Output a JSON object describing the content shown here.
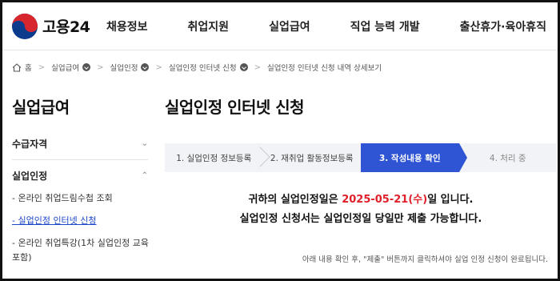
{
  "header": {
    "logo_text": "고용24",
    "menu": [
      "채용정보",
      "취업지원",
      "실업급여",
      "직업 능력 개발",
      "출산휴가·육아휴직"
    ]
  },
  "breadcrumb": {
    "home": "홈",
    "items": [
      "실업급여",
      "실업인정",
      "실업인정 인터넷 신청",
      "실업인정 인터넷 신청 내역 상세보기"
    ]
  },
  "sidebar": {
    "title": "실업급여",
    "groups": [
      {
        "label": "수급자격",
        "expanded": false
      },
      {
        "label": "실업인정",
        "expanded": true
      }
    ],
    "subitems": [
      {
        "label": "- 온라인 취업드림수첩 조회",
        "active": false
      },
      {
        "label": "- 실업인정 인터넷 신청",
        "active": true
      },
      {
        "label": "- 온라인 취업특강(1차 실업인정 교육 포함)",
        "active": false
      }
    ]
  },
  "main": {
    "title": "실업인정 인터넷 신청",
    "steps": [
      {
        "label": "1. 실업인정 정보등록",
        "state": "done"
      },
      {
        "label": "2. 재취업 활동정보등록",
        "state": "done"
      },
      {
        "label": "3. 작성내용 확인",
        "state": "current"
      },
      {
        "label": "4. 처리 중",
        "state": "todo"
      }
    ],
    "notice": {
      "line1_prefix": "귀하의 실업인정일은 ",
      "line1_date": "2025-05-21(수)",
      "line1_suffix": "일 입니다.",
      "line2": "실업인정 신청서는 실업인정일 당일만 제출 가능합니다."
    },
    "footnote": "아래 내용 확인 후, \"제출\" 버튼까지 클릭하셔야 실업 인정 신청이 완료됩니다."
  },
  "colors": {
    "accent": "#2f55d4",
    "date_red": "#e0202a",
    "active_link": "#1e46c8"
  }
}
